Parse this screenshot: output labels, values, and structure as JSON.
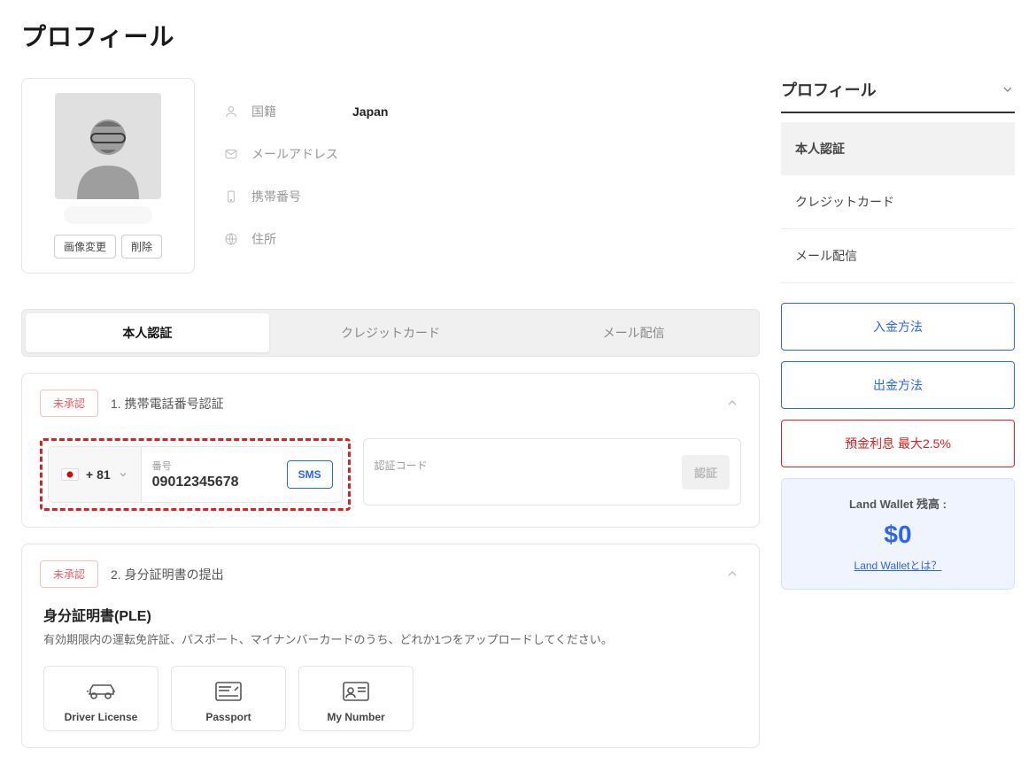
{
  "page_title": "プロフィール",
  "avatar": {
    "change_btn": "画像変更",
    "delete_btn": "削除"
  },
  "profile_fields": {
    "nationality": {
      "label": "国籍",
      "value": "Japan"
    },
    "email": {
      "label": "メールアドレス",
      "value": ""
    },
    "phone": {
      "label": "携帯番号",
      "value": ""
    },
    "address": {
      "label": "住所",
      "value": ""
    }
  },
  "tabs": {
    "identity": "本人認証",
    "credit_card": "クレジットカード",
    "mail": "メール配信"
  },
  "verification": {
    "unapproved_badge": "未承認",
    "phone_section_title": "1. 携帯電話番号認証",
    "country_code": "+ 81",
    "phone_label": "番号",
    "phone_value": "09012345678",
    "sms_btn": "SMS",
    "code_label": "認証コード",
    "verify_btn": "認証",
    "id_section_title": "2. 身分証明書の提出",
    "id_heading": "身分証明書(PLE)",
    "id_desc": "有効期限内の運転免許証、パスポート、マイナンバーカードのうち、どれか1つをアップロードしてください。",
    "doc_driver": "Driver License",
    "doc_passport": "Passport",
    "doc_mynumber": "My Number"
  },
  "sidebar": {
    "header": "プロフィール",
    "nav": {
      "identity": "本人認証",
      "credit_card": "クレジットカード",
      "mail": "メール配信"
    },
    "btn_deposit": "入金方法",
    "btn_withdraw": "出金方法",
    "btn_interest": "預金利息 最大2.5%",
    "wallet": {
      "label": "Land Wallet 残高 :",
      "amount": "$0",
      "link": "Land Walletとは？"
    }
  }
}
